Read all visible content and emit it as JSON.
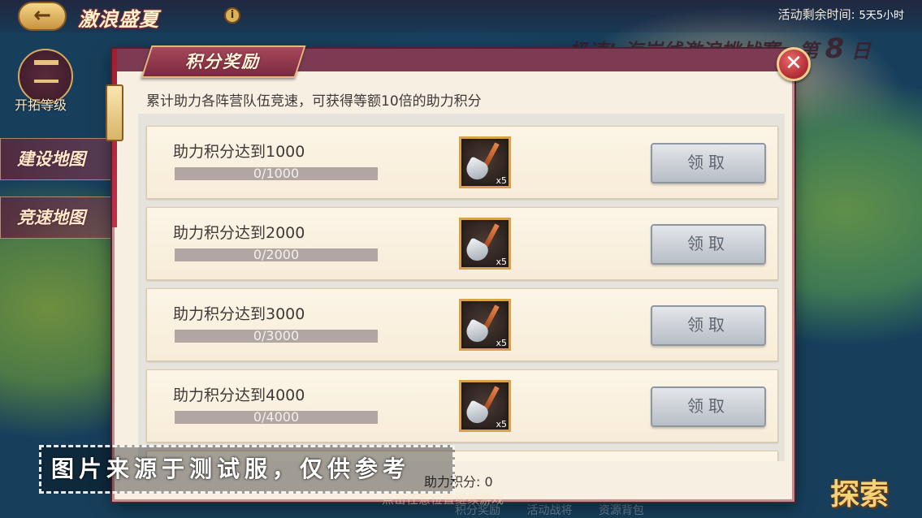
{
  "header": {
    "back_icon": "←",
    "event_title": "激浪盛夏",
    "info_icon": "i",
    "time_label": "活动剩余时间:",
    "time_value": "5天5小时",
    "banner": "极速! 海岸线激浪挑战赛—第",
    "banner_day": "8",
    "banner_suffix": "日"
  },
  "sidebar": {
    "level_label": "开拓等级",
    "build_map": "建设地图",
    "race_map": "竞速地图"
  },
  "dialog": {
    "title": "积分奖励",
    "close_icon": "✕",
    "description": "累计助力各阵营队伍竞速，可获得等额10倍的助力积分",
    "points_label": "助力积分:",
    "points_value": "0",
    "rewards": [
      {
        "title": "助力积分达到1000",
        "progress_text": "0/1000",
        "progress": 0,
        "item_qty": "x5",
        "claim_label": "领取"
      },
      {
        "title": "助力积分达到2000",
        "progress_text": "0/2000",
        "progress": 0,
        "item_qty": "x5",
        "claim_label": "领取"
      },
      {
        "title": "助力积分达到3000",
        "progress_text": "0/3000",
        "progress": 0,
        "item_qty": "x5",
        "claim_label": "领取"
      },
      {
        "title": "助力积分达到4000",
        "progress_text": "0/4000",
        "progress": 0,
        "item_qty": "x5",
        "claim_label": "领取"
      }
    ]
  },
  "bottom": {
    "hint": "点击任意位置继续游戏",
    "explore": "探索",
    "tabs": [
      "积分奖励",
      "活动战将",
      "资源背包"
    ]
  },
  "watermark": "图片来源于测试服，仅供参考",
  "colors": {
    "dialog_header": "#7c3b52",
    "dialog_bg": "#f6efe2",
    "claim_button": "#c9ced4",
    "item_frame": "#d9a24a"
  }
}
